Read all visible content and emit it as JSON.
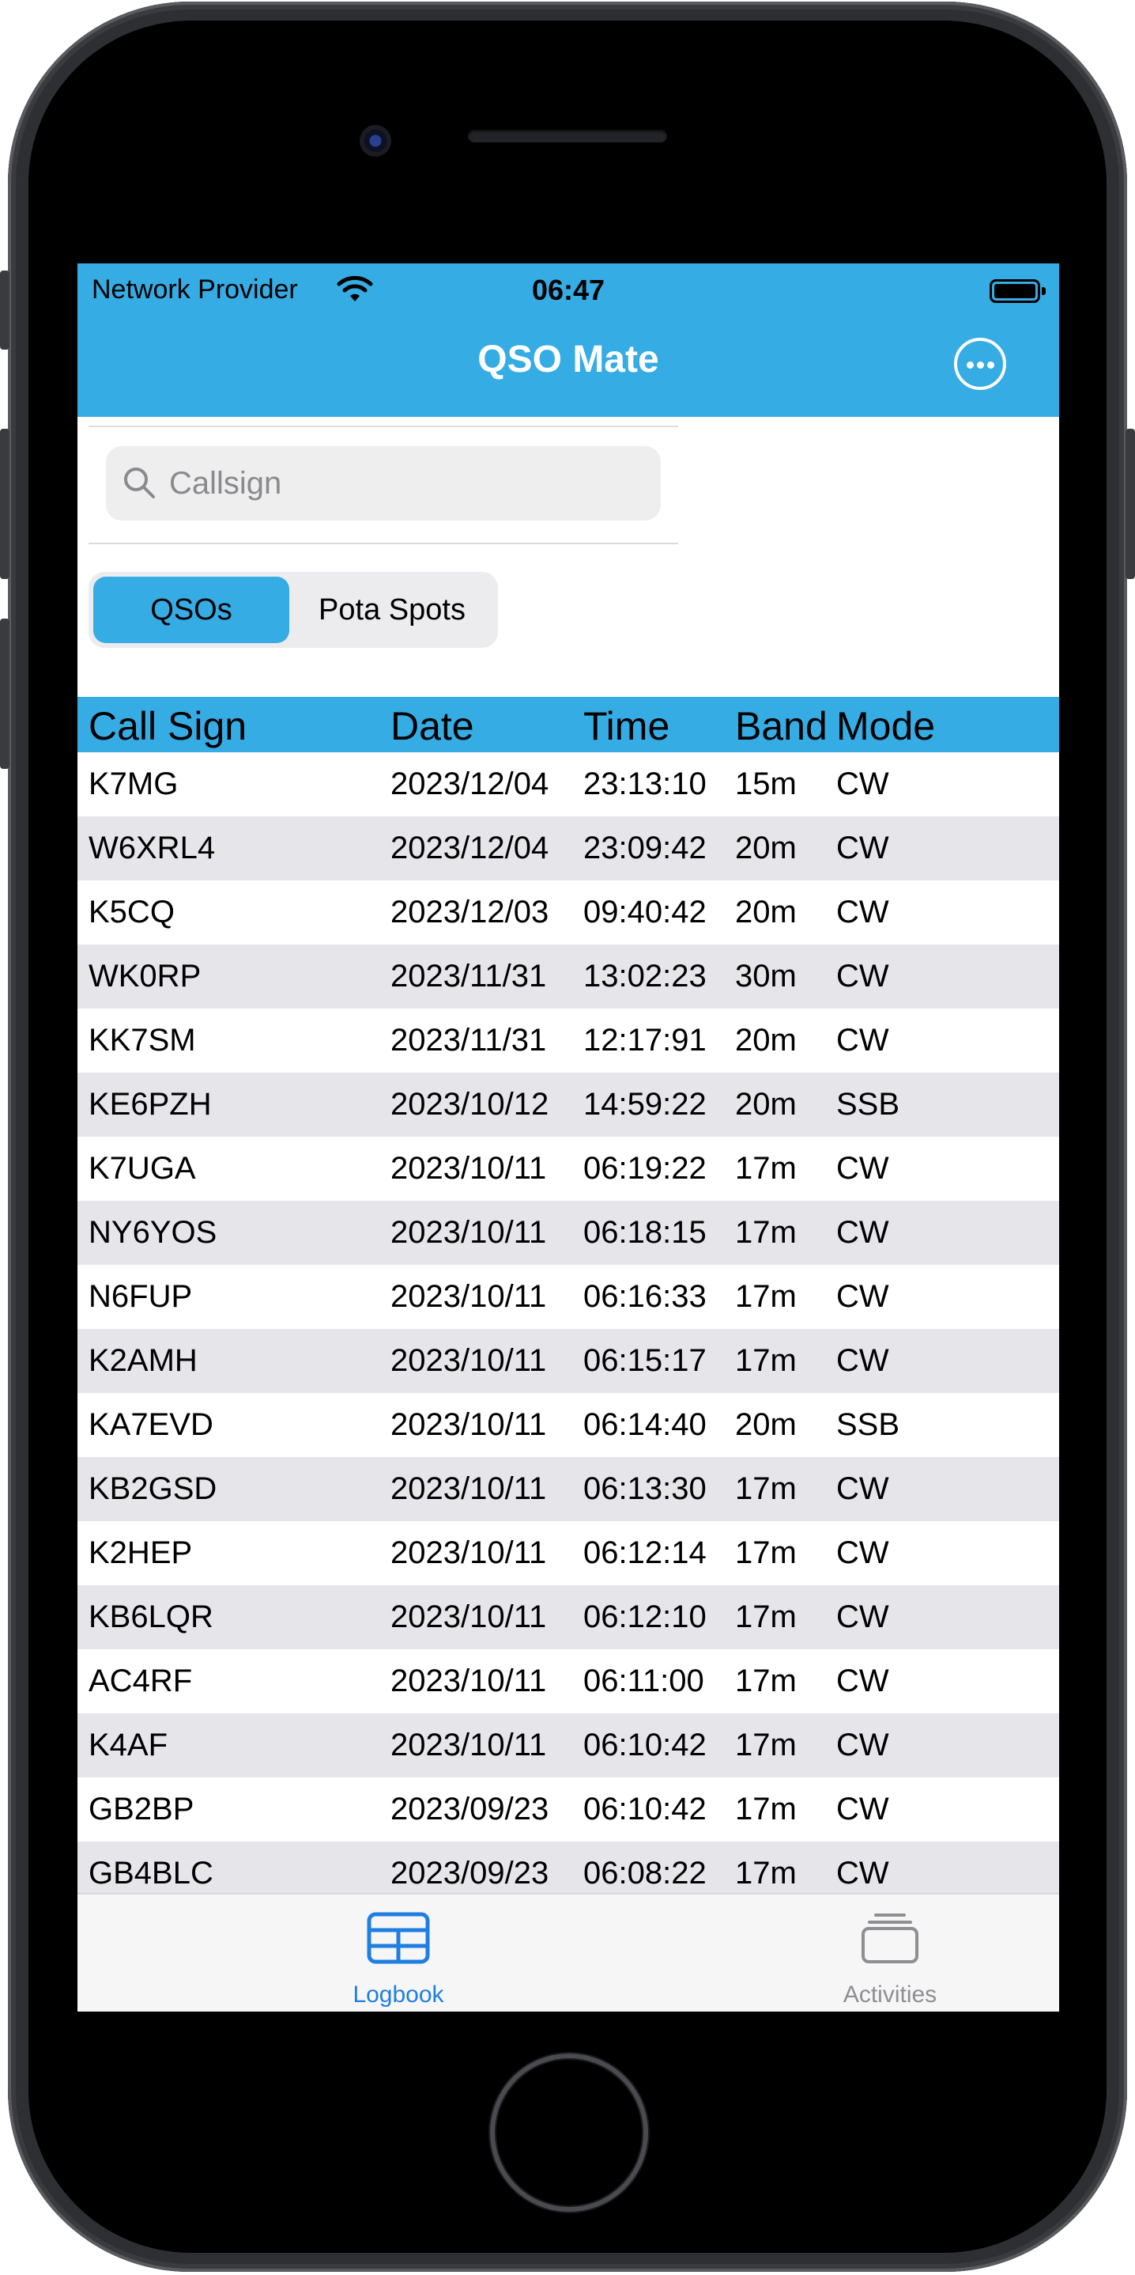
{
  "status_bar": {
    "carrier": "Network Provider",
    "time": "06:47"
  },
  "nav": {
    "title": "QSO Mate",
    "more_icon": "ellipsis-circle-icon"
  },
  "search": {
    "placeholder": "Callsign",
    "value": ""
  },
  "segments": [
    {
      "label": "QSOs",
      "selected": true
    },
    {
      "label": "Pota Spots",
      "selected": false
    }
  ],
  "table": {
    "columns": [
      "Call Sign",
      "Date",
      "Time",
      "Band",
      "Mode"
    ],
    "rows": [
      [
        "K7MG",
        "2023/12/04",
        "23:13:10",
        "15m",
        "CW"
      ],
      [
        "W6XRL4",
        "2023/12/04",
        "23:09:42",
        "20m",
        "CW"
      ],
      [
        "K5CQ",
        "2023/12/03",
        "09:40:42",
        "20m",
        "CW"
      ],
      [
        "WK0RP",
        "2023/11/31",
        "13:02:23",
        "30m",
        "CW"
      ],
      [
        "KK7SM",
        "2023/11/31",
        "12:17:91",
        "20m",
        "CW"
      ],
      [
        "KE6PZH",
        "2023/10/12",
        "14:59:22",
        "20m",
        "SSB"
      ],
      [
        "K7UGA",
        "2023/10/11",
        "06:19:22",
        "17m",
        "CW"
      ],
      [
        "NY6YOS",
        "2023/10/11",
        "06:18:15",
        "17m",
        "CW"
      ],
      [
        "N6FUP",
        "2023/10/11",
        "06:16:33",
        "17m",
        "CW"
      ],
      [
        "K2AMH",
        "2023/10/11",
        "06:15:17",
        "17m",
        "CW"
      ],
      [
        "KA7EVD",
        "2023/10/11",
        "06:14:40",
        "20m",
        "SSB"
      ],
      [
        "KB2GSD",
        "2023/10/11",
        "06:13:30",
        "17m",
        "CW"
      ],
      [
        "K2HEP",
        "2023/10/11",
        "06:12:14",
        "17m",
        "CW"
      ],
      [
        "KB6LQR",
        "2023/10/11",
        "06:12:10",
        "17m",
        "CW"
      ],
      [
        "AC4RF",
        "2023/10/11",
        "06:11:00",
        "17m",
        "CW"
      ],
      [
        "K4AF",
        "2023/10/11",
        "06:10:42",
        "17m",
        "CW"
      ],
      [
        "GB2BP",
        "2023/09/23",
        "06:10:42",
        "17m",
        "CW"
      ],
      [
        "GB4BLC",
        "2023/09/23",
        "06:08:22",
        "17m",
        "CW"
      ]
    ]
  },
  "tab_bar": {
    "tabs": [
      {
        "label": "Logbook",
        "icon": "table-icon",
        "selected": true
      },
      {
        "label": "Activities",
        "icon": "stack-icon",
        "selected": false
      }
    ]
  },
  "colors": {
    "accent": "#35ace4",
    "row_alt": "#e6e6ea",
    "tab_selected": "#1f7fe0",
    "tab_unselected": "#8e8e93"
  }
}
